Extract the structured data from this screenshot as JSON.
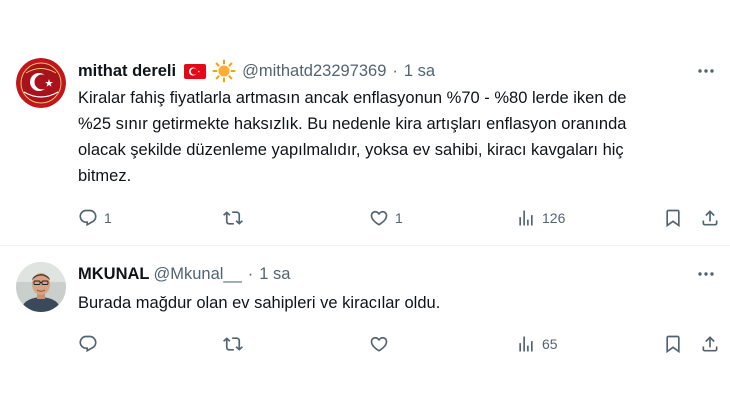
{
  "tweets": [
    {
      "author_name": "mithat dereli",
      "handle": "@mithatd23297369",
      "separator": "·",
      "time": "1 sa",
      "flag_icon": "turkey-flag-icon",
      "emoji_icon": "sun-emoji-icon",
      "text": "Kiralar fahiş fiyatlarla artmasın ancak enflasyonun %70 - %80 lerde iken de\n%25 sınır getirmekte haksızlık. Bu nedenle kira artışları enflasyon oranında\nolacak şekilde düzenleme yapılmalıdır, yoksa ev sahibi, kiracı kavgaları hiç\nbitmez.",
      "replies": "1",
      "retweets": "",
      "likes": "1",
      "views": "126"
    },
    {
      "author_name": "MKUNAL",
      "handle": "@Mkunal__",
      "separator": "·",
      "time": "1 sa",
      "text": "Burada mağdur olan ev sahipleri ve kiracılar oldu.",
      "replies": "",
      "retweets": "",
      "likes": "",
      "views": "65"
    }
  ],
  "colors": {
    "text_primary": "#0f1419",
    "text_secondary": "#536471",
    "divider": "#eff3f4"
  }
}
